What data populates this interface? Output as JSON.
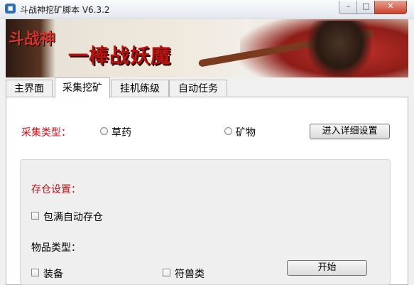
{
  "window": {
    "title": "斗战神挖矿脚本 V6.3.2",
    "controls": {
      "minimize": "–",
      "maximize": "□",
      "close": "✕"
    }
  },
  "banner": {
    "logo_text": "斗战神",
    "slogan": "一棒战妖魔"
  },
  "tabs": [
    {
      "label": "主界面",
      "active": false
    },
    {
      "label": "采集挖矿",
      "active": true
    },
    {
      "label": "挂机练级",
      "active": false
    },
    {
      "label": "自动任务",
      "active": false
    }
  ],
  "collect": {
    "type_label": "采集类型：",
    "options": [
      {
        "label": "草药",
        "selected": false
      },
      {
        "label": "矿物",
        "selected": false
      }
    ],
    "detail_button": "进入详细设置"
  },
  "storage": {
    "title": "存仓设置：",
    "auto_store_label": "包满自动存仓",
    "auto_store_checked": false,
    "item_type_label": "物品类型：",
    "item_types": [
      {
        "label": "装备",
        "checked": false
      },
      {
        "label": "符兽类",
        "checked": false
      }
    ],
    "start_button": "开始"
  },
  "colors": {
    "accent_red": "#c0101a",
    "close_button": "#c8422e"
  }
}
